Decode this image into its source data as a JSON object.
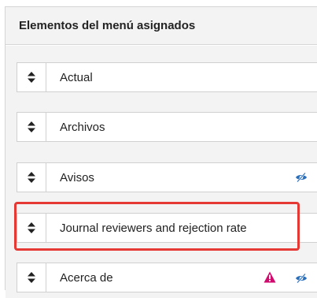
{
  "panel": {
    "title": "Elementos del menú asignados"
  },
  "items": [
    {
      "label": "Actual",
      "hidden_icon": false,
      "warning_icon": false
    },
    {
      "label": "Archivos",
      "hidden_icon": false,
      "warning_icon": false
    },
    {
      "label": "Avisos",
      "hidden_icon": true,
      "warning_icon": false
    },
    {
      "label": "Journal reviewers and rejection rate",
      "hidden_icon": false,
      "warning_icon": false,
      "highlighted": true
    },
    {
      "label": "Acerca de",
      "hidden_icon": true,
      "warning_icon": true
    }
  ],
  "colors": {
    "highlight": "#e53935",
    "eye_icon": "#2a6ebb",
    "warning_icon": "#d10a6e"
  }
}
